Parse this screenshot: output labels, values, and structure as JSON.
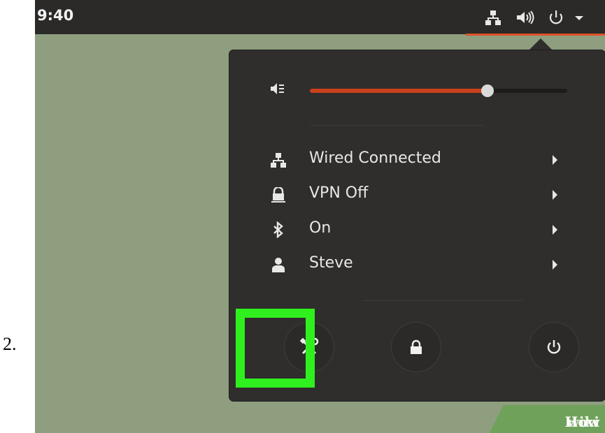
{
  "step_number": "2.",
  "topbar": {
    "clock": "9:40",
    "icons": [
      "network-icon",
      "volume-icon",
      "power-icon",
      "dropdown-arrow-icon"
    ],
    "accent_color": "#e0502a"
  },
  "menu": {
    "volume": {
      "icon": "speaker-icon",
      "level": 0.69,
      "fill_color": "#c9411d"
    },
    "items": [
      {
        "icon": "network-icon",
        "label": "Wired Connected"
      },
      {
        "icon": "vpn-icon",
        "label": "VPN Off"
      },
      {
        "icon": "bluetooth-icon",
        "label": "On"
      },
      {
        "icon": "user-icon",
        "label": "Steve"
      }
    ],
    "buttons": [
      {
        "icon": "settings-icon",
        "highlighted": true
      },
      {
        "icon": "lock-icon",
        "highlighted": false
      },
      {
        "icon": "power-icon",
        "highlighted": false
      }
    ],
    "highlight_color": "#2ff01e"
  },
  "watermark": {
    "part1": "wiki",
    "part2": "How"
  }
}
